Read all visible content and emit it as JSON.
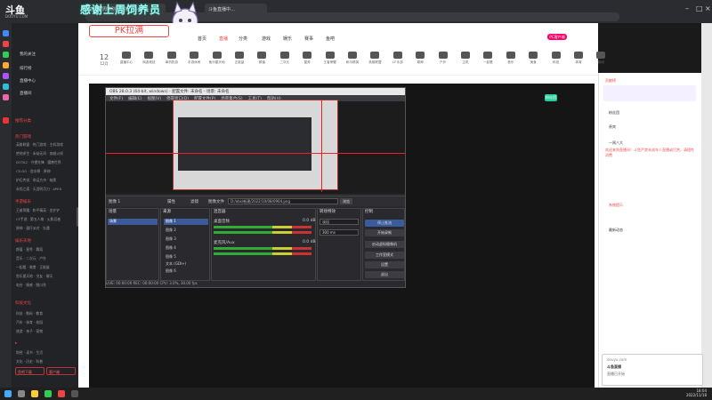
{
  "browser": {
    "logo_text": "斗鱼",
    "logo_url": "DOUYU.COM",
    "tab1": "感谢上周特别…直播 · 斗鱼",
    "tab2": "斗鱼直播中…",
    "banner_text": "感谢上周饲养员"
  },
  "page": {
    "header_badge": "PK拉满",
    "nav": [
      "首页",
      "直播",
      "分类",
      "游戏",
      "娱乐",
      "赛事",
      "鱼吧"
    ],
    "right_button": "PC客户端",
    "date_day": "12",
    "date_label": "12月",
    "categories": [
      "直播中心",
      "网游竞技",
      "单机热游",
      "手游休闲",
      "鱼乐星天地",
      "正能量",
      "颜值",
      "二次元",
      "星秀",
      "王者荣耀",
      "和平精英",
      "英雄联盟",
      "CF手游",
      "原神",
      "户外",
      "主机",
      "一起看",
      "音乐",
      "美食",
      "科技",
      "体育",
      "数码",
      "校园",
      "旅游"
    ],
    "stream_title": "",
    "fan_badge": "粉丝团"
  },
  "sidebar": {
    "items": [
      "我的关注",
      "排行榜",
      "直播中心",
      "直播间"
    ],
    "section1": "推荐分类",
    "section2": "热门游戏",
    "section3": "手游娱乐",
    "section4": "娱乐天地",
    "section5": "科技文化",
    "btn1": "鱼吧下载",
    "btn2": "客户端"
  },
  "obs": {
    "title": "OBS 28.0.3 (64-bit, windows) - 配置文件: 未命名 - 场景: 未命名",
    "menu": [
      "文件(F)",
      "编辑(E)",
      "视图(V)",
      "停靠窗口(D)",
      "配置文件(P)",
      "场景集合(S)",
      "工具(T)",
      "帮助(H)"
    ],
    "bar_label": "图像 1",
    "props": "属性",
    "filters": "滤镜",
    "image_file": "图像文件",
    "path": "D:/obs/新建/2022/10/08/0904.png",
    "browse": "浏览",
    "docks": [
      "场景",
      "来源",
      "混音器",
      "转场特效",
      "控制"
    ],
    "scene": "场景",
    "sources": [
      "图像 1",
      "图像 2",
      "图像 3",
      "图像 4",
      "图像 5",
      "文本 (GDI+)",
      "图像 6"
    ],
    "mixer": [
      "桌面音频",
      "麦克风/Aux"
    ],
    "db": "0.0 dB",
    "transition": "淡出",
    "duration": "300 ms",
    "controls": [
      "停止推流",
      "开始录制",
      "启动虚拟摄像机",
      "工作室模式",
      "设置",
      "退出"
    ],
    "status": "LIVE: 00:00:00   REC: 00:00:00   CPU: 3.0%, 30.00 fps"
  },
  "right": {
    "top_label": "贡献榜",
    "lines": [
      "粉丝团",
      "贵宾",
      "一周八大",
      "欢迎来到直播间！斗鱼严禁未成年人直播或打赏，请理性消费",
      "系统提示",
      "最新动态"
    ],
    "notif_title": "斗鱼直播",
    "notif_sub": "直播已开始",
    "notif_url": "douyu.com"
  },
  "clock": {
    "time": "18:04",
    "date": "2022/11/18"
  }
}
